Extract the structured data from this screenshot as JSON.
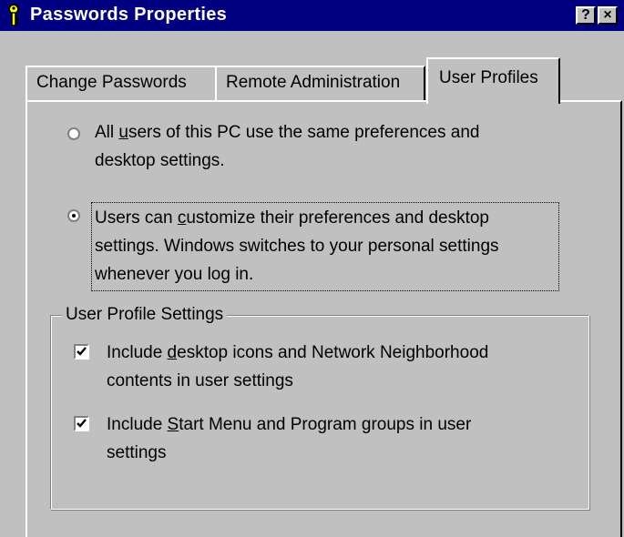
{
  "window": {
    "title": "Passwords Properties"
  },
  "caption_buttons": {
    "help": "?",
    "close": "×"
  },
  "tabs": [
    {
      "label": "Change Passwords",
      "selected": false
    },
    {
      "label": "Remote Administration",
      "selected": false
    },
    {
      "label": "User Profiles",
      "selected": true
    }
  ],
  "profile_options": {
    "same_prefs": {
      "selected": false,
      "pre": "All ",
      "accel": "u",
      "post": "sers of this PC use the same preferences and",
      "line2": "desktop settings."
    },
    "customize": {
      "selected": true,
      "pre": "Users can ",
      "accel": "c",
      "post": "ustomize their preferences and desktop",
      "line2": "settings.  Windows switches to your personal settings",
      "line3": "whenever you log in."
    }
  },
  "group": {
    "label": "User Profile Settings",
    "desktop_icons": {
      "checked": true,
      "pre": "Include ",
      "accel": "d",
      "post": "esktop icons and Network Neighborhood",
      "line2": "contents in user settings"
    },
    "start_menu": {
      "checked": true,
      "pre": "Include ",
      "accel": "S",
      "post": "tart Menu and Program groups in user",
      "line2": "settings"
    }
  }
}
